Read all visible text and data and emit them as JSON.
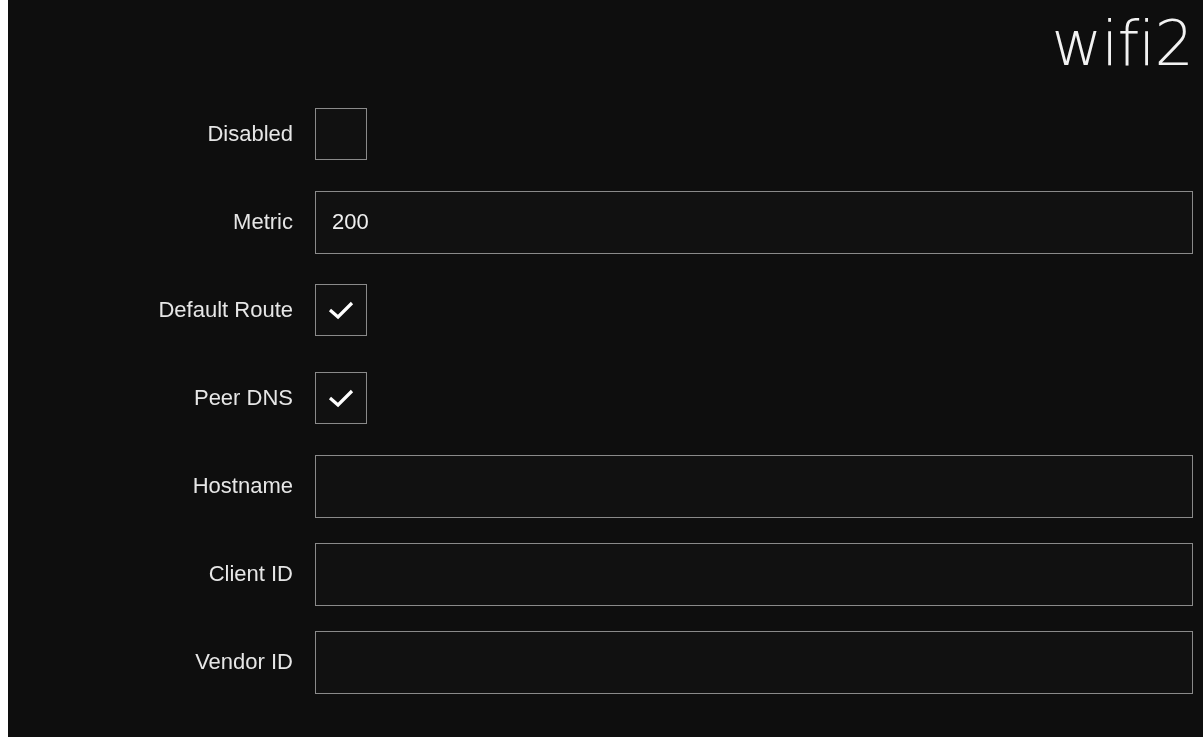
{
  "title": "wifi2",
  "fields": [
    {
      "kind": "checkbox",
      "label": "Disabled",
      "checked": false
    },
    {
      "kind": "text",
      "label": "Metric",
      "value": "200"
    },
    {
      "kind": "checkbox",
      "label": "Default Route",
      "checked": true
    },
    {
      "kind": "checkbox",
      "label": "Peer DNS",
      "checked": true
    },
    {
      "kind": "text",
      "label": "Hostname"
    },
    {
      "kind": "text",
      "label": "Client ID"
    },
    {
      "kind": "text",
      "label": "Vendor ID"
    }
  ]
}
